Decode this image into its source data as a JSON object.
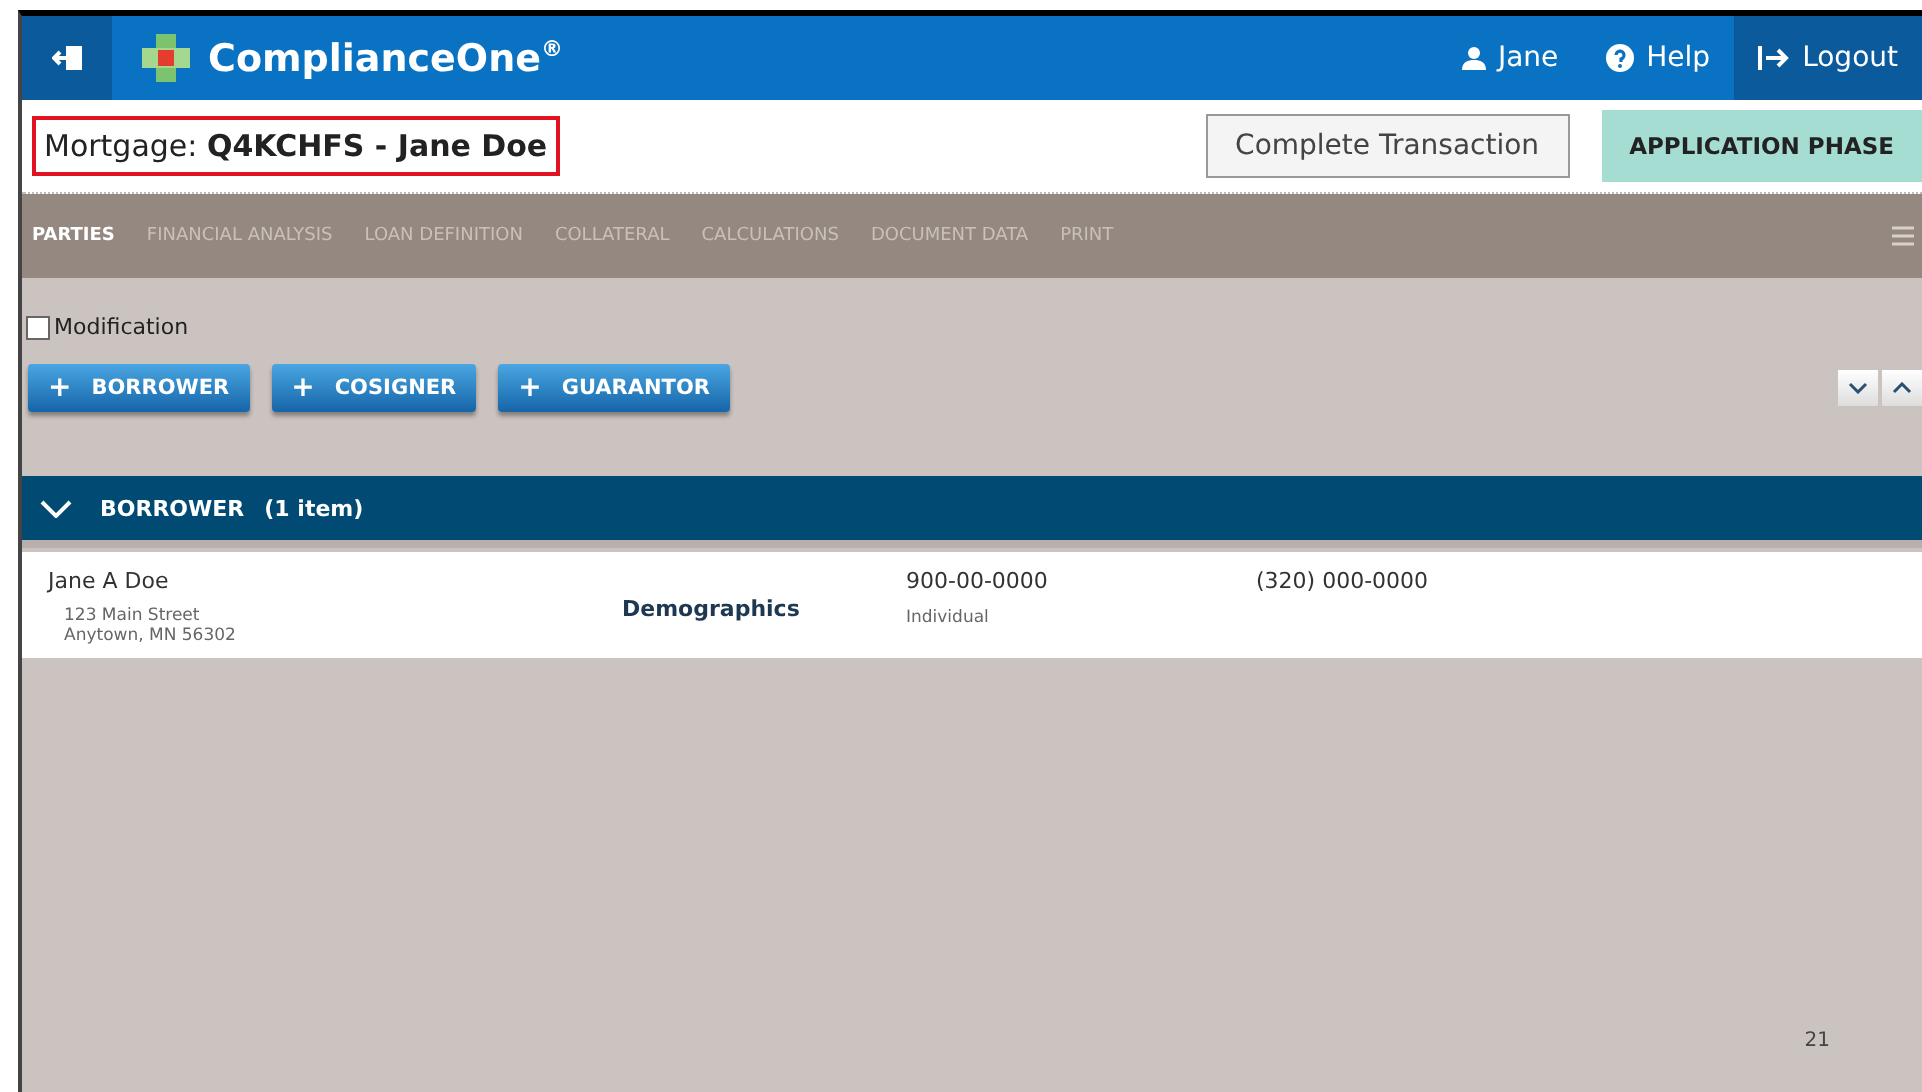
{
  "topbar": {
    "logo": "ComplianceOne$^{®}$",
    "user": "Jane",
    "help": "Help",
    "logout": "Logout"
  },
  "header": {
    "title": "Mortgage: **Q4KCHFS - Jane Doe**",
    "complete_button": "Complete Transaction",
    "phase": "APPLICATION PHASE"
  },
  "tabs": [
    {
      "label": "PARTIES",
      "selected": true
    },
    {
      "label": "FINANCIAL ANALYSIS",
      "selected": false
    },
    {
      "label": "LOAN DEFINITION",
      "selected": false
    },
    {
      "label": "COLLATERAL",
      "selected": false
    },
    {
      "label": "CALCULATIONS",
      "selected": false
    },
    {
      "label": "DOCUMENT DATA",
      "selected": false
    },
    {
      "label": "PRINT",
      "selected": false
    }
  ],
  "modification": {
    "label": "Modification",
    "checked": false
  },
  "add_buttons": [
    {
      "icon": "+",
      "label": "BORROWER"
    },
    {
      "icon": "+",
      "label": "COSIGNER"
    },
    {
      "icon": "+",
      "label": "GUARANTOR"
    }
  ],
  "section": {
    "title": "BORROWER",
    "count": "(1 item)",
    "expanded": true
  },
  "rows": [
    {
      "name": "Jane A Doe",
      "address_line_1": "123 Main Street",
      "address_line_2": "Anytown,  MN  56302",
      "link": "Demographics",
      "tax_id": "900-00-0000",
      "type": "Individual",
      "phone": "(320) 000-0000"
    }
  ],
  "page_number": "21"
}
